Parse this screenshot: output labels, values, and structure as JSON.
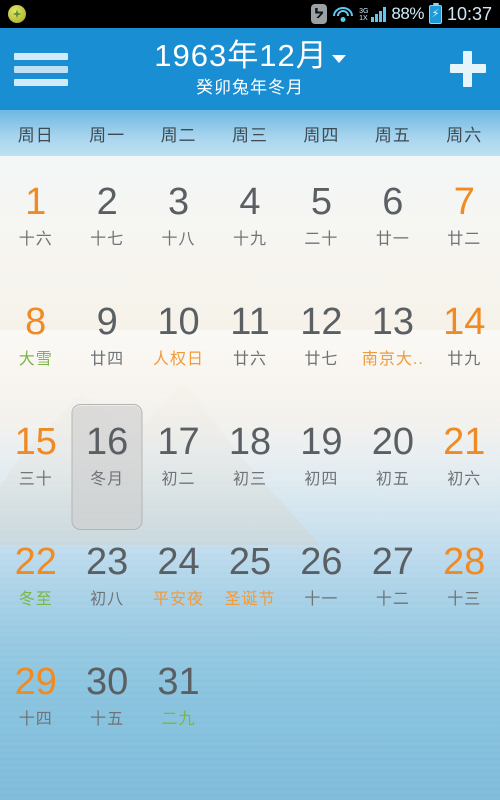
{
  "statusbar": {
    "app_icon": "app-notification-icon",
    "bluetooth_icon": "bluetooth-icon",
    "wifi_icon": "wifi-icon",
    "network_label_top": "3G",
    "network_label_bottom": "1X",
    "signal_icon": "signal-bars-icon",
    "battery_percent": "88%",
    "battery_icon": "battery-charging-icon",
    "battery_glyph": "⚡",
    "clock": "10:37"
  },
  "header": {
    "menu_icon": "hamburger-menu-icon",
    "title": "1963年12月",
    "caret_icon": "chevron-down-icon",
    "subtitle": "癸卯兔年冬月",
    "add_icon": "plus-icon",
    "accent_color": "#1a8ed2"
  },
  "weekdays": [
    "周日",
    "周一",
    "周二",
    "周三",
    "周四",
    "周五",
    "周六"
  ],
  "colors": {
    "weekend": "#f08a22",
    "weekday": "#5a5f63",
    "lunar": "#6f7478",
    "festival": "#f09a3c",
    "solar_term": "#7ab648",
    "selection": "#cdcdcd"
  },
  "selected_day": 16,
  "days": [
    {
      "num": "1",
      "lunar": "十六",
      "weekend": true,
      "lunar_style": "plain"
    },
    {
      "num": "2",
      "lunar": "十七",
      "weekend": false,
      "lunar_style": "plain"
    },
    {
      "num": "3",
      "lunar": "十八",
      "weekend": false,
      "lunar_style": "plain"
    },
    {
      "num": "4",
      "lunar": "十九",
      "weekend": false,
      "lunar_style": "plain"
    },
    {
      "num": "5",
      "lunar": "二十",
      "weekend": false,
      "lunar_style": "plain"
    },
    {
      "num": "6",
      "lunar": "廿一",
      "weekend": false,
      "lunar_style": "plain"
    },
    {
      "num": "7",
      "lunar": "廿二",
      "weekend": true,
      "lunar_style": "plain"
    },
    {
      "num": "8",
      "lunar": "大雪",
      "weekend": true,
      "lunar_style": "green"
    },
    {
      "num": "9",
      "lunar": "廿四",
      "weekend": false,
      "lunar_style": "plain"
    },
    {
      "num": "10",
      "lunar": "人权日",
      "weekend": false,
      "lunar_style": "orange"
    },
    {
      "num": "11",
      "lunar": "廿六",
      "weekend": false,
      "lunar_style": "plain"
    },
    {
      "num": "12",
      "lunar": "廿七",
      "weekend": false,
      "lunar_style": "plain"
    },
    {
      "num": "13",
      "lunar": "南京大..",
      "weekend": false,
      "lunar_style": "orange"
    },
    {
      "num": "14",
      "lunar": "廿九",
      "weekend": true,
      "lunar_style": "plain"
    },
    {
      "num": "15",
      "lunar": "三十",
      "weekend": true,
      "lunar_style": "plain"
    },
    {
      "num": "16",
      "lunar": "冬月",
      "weekend": false,
      "lunar_style": "plain"
    },
    {
      "num": "17",
      "lunar": "初二",
      "weekend": false,
      "lunar_style": "plain"
    },
    {
      "num": "18",
      "lunar": "初三",
      "weekend": false,
      "lunar_style": "plain"
    },
    {
      "num": "19",
      "lunar": "初四",
      "weekend": false,
      "lunar_style": "plain"
    },
    {
      "num": "20",
      "lunar": "初五",
      "weekend": false,
      "lunar_style": "plain"
    },
    {
      "num": "21",
      "lunar": "初六",
      "weekend": true,
      "lunar_style": "plain"
    },
    {
      "num": "22",
      "lunar": "冬至",
      "weekend": true,
      "lunar_style": "green"
    },
    {
      "num": "23",
      "lunar": "初八",
      "weekend": false,
      "lunar_style": "plain"
    },
    {
      "num": "24",
      "lunar": "平安夜",
      "weekend": false,
      "lunar_style": "orange"
    },
    {
      "num": "25",
      "lunar": "圣诞节",
      "weekend": false,
      "lunar_style": "orange"
    },
    {
      "num": "26",
      "lunar": "十一",
      "weekend": false,
      "lunar_style": "plain"
    },
    {
      "num": "27",
      "lunar": "十二",
      "weekend": false,
      "lunar_style": "plain"
    },
    {
      "num": "28",
      "lunar": "十三",
      "weekend": true,
      "lunar_style": "plain"
    },
    {
      "num": "29",
      "lunar": "十四",
      "weekend": true,
      "lunar_style": "plain"
    },
    {
      "num": "30",
      "lunar": "十五",
      "weekend": false,
      "lunar_style": "plain"
    },
    {
      "num": "31",
      "lunar": "二九",
      "weekend": false,
      "lunar_style": "green"
    }
  ]
}
